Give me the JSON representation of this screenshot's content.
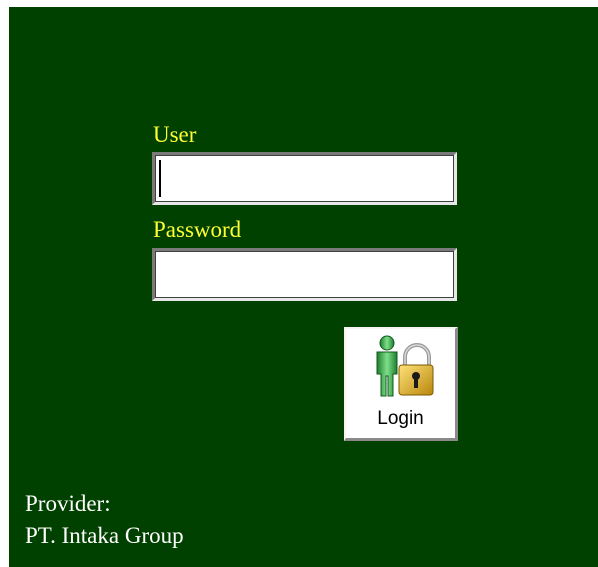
{
  "login_form": {
    "user_label": "User",
    "user_value": "",
    "password_label": "Password",
    "password_value": "",
    "login_button": {
      "label": "Login",
      "icon": "user-lock-icon"
    }
  },
  "footer": {
    "provider_label": "Provider:",
    "provider_name": "PT. Intaka Group"
  },
  "colors": {
    "background": "#004100",
    "label_text": "#ffff33",
    "footer_text": "#ffffff"
  }
}
